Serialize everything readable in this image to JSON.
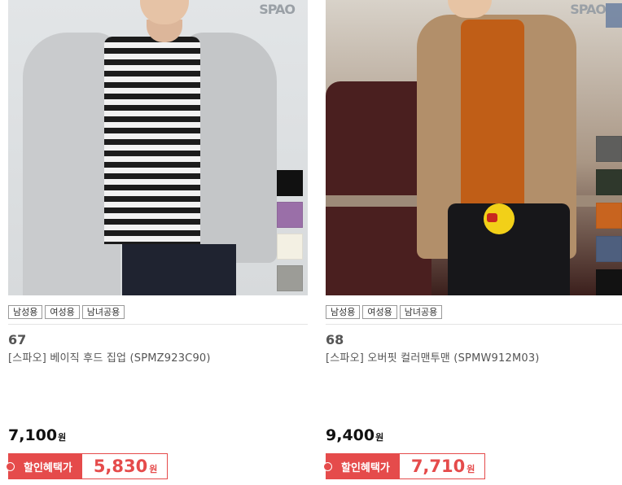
{
  "products": [
    {
      "brand_mark": "SPAO",
      "tags": [
        "남성용",
        "여성용",
        "남녀공용"
      ],
      "number": "67",
      "name": "[스파오] 베이직 후드 집업 (SPMZ923C90)",
      "price": "7,100",
      "currency": "원",
      "sale_label": "할인혜택가",
      "sale_price": "5,830",
      "swatch_colors": [
        "#111111",
        "#9a6fa8",
        "#f3f0e3",
        "#9c9c97"
      ]
    },
    {
      "brand_mark": "SPAO",
      "tags": [
        "남성용",
        "여성용",
        "남녀공용"
      ],
      "number": "68",
      "name": "[스파오] 오버핏 컬러맨투맨 (SPMW912M03)",
      "price": "9,400",
      "currency": "원",
      "sale_label": "할인혜택가",
      "sale_price": "7,710",
      "swatch_colors": [
        "#5e5e5c",
        "#2f382c",
        "#c8641f",
        "#4e5f7e",
        "#121212"
      ]
    }
  ],
  "colors": {
    "accent": "#e54b4b"
  }
}
